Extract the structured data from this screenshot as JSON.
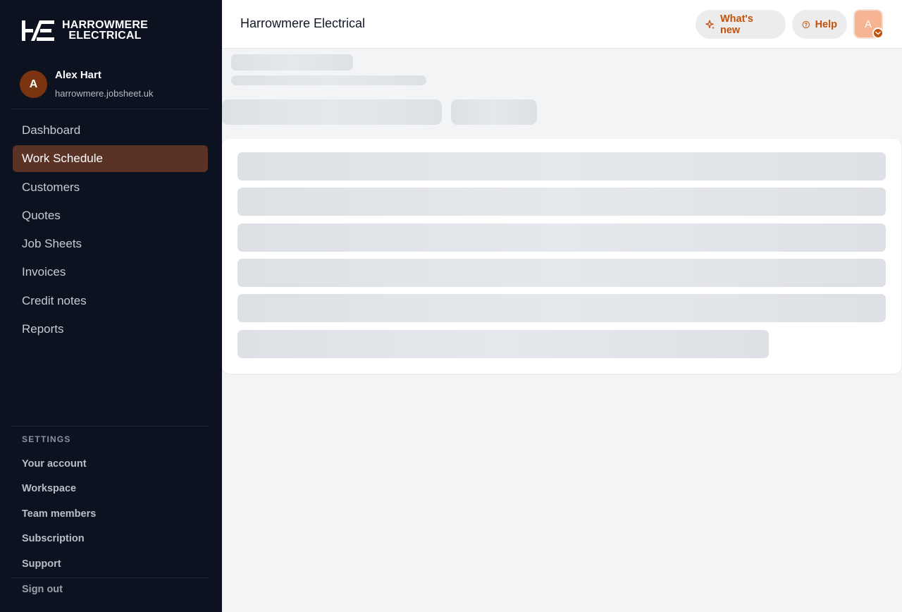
{
  "brand": {
    "logo_line1": "HARROWMERE",
    "logo_line2": "ELECTRICAL"
  },
  "user": {
    "initial": "A",
    "name": "Alex Hart",
    "domain": "harrowmere.jobsheet.uk"
  },
  "nav": {
    "items": [
      {
        "label": "Dashboard",
        "active": false
      },
      {
        "label": "Work Schedule",
        "active": true
      },
      {
        "label": "Customers",
        "active": false
      },
      {
        "label": "Quotes",
        "active": false
      },
      {
        "label": "Job Sheets",
        "active": false
      },
      {
        "label": "Invoices",
        "active": false
      },
      {
        "label": "Credit notes",
        "active": false
      },
      {
        "label": "Reports",
        "active": false
      }
    ]
  },
  "settings": {
    "heading": "SETTINGS",
    "items": [
      "Your account",
      "Workspace",
      "Team members",
      "Subscription",
      "Support"
    ],
    "sign_out": "Sign out"
  },
  "header": {
    "title": "Harrowmere Electrical",
    "whats_new": "What's new",
    "help": "Help",
    "avatar_initial": "A"
  },
  "colors": {
    "sidebar_bg": "#0c1220",
    "active_nav_bg": "#5a3226",
    "accent": "#c2520c",
    "avatar_bg": "#f6b493"
  },
  "icons": {
    "whats_new": "sparkle-icon",
    "help": "question-circle-icon",
    "avatar_caret": "chevron-down-icon"
  }
}
